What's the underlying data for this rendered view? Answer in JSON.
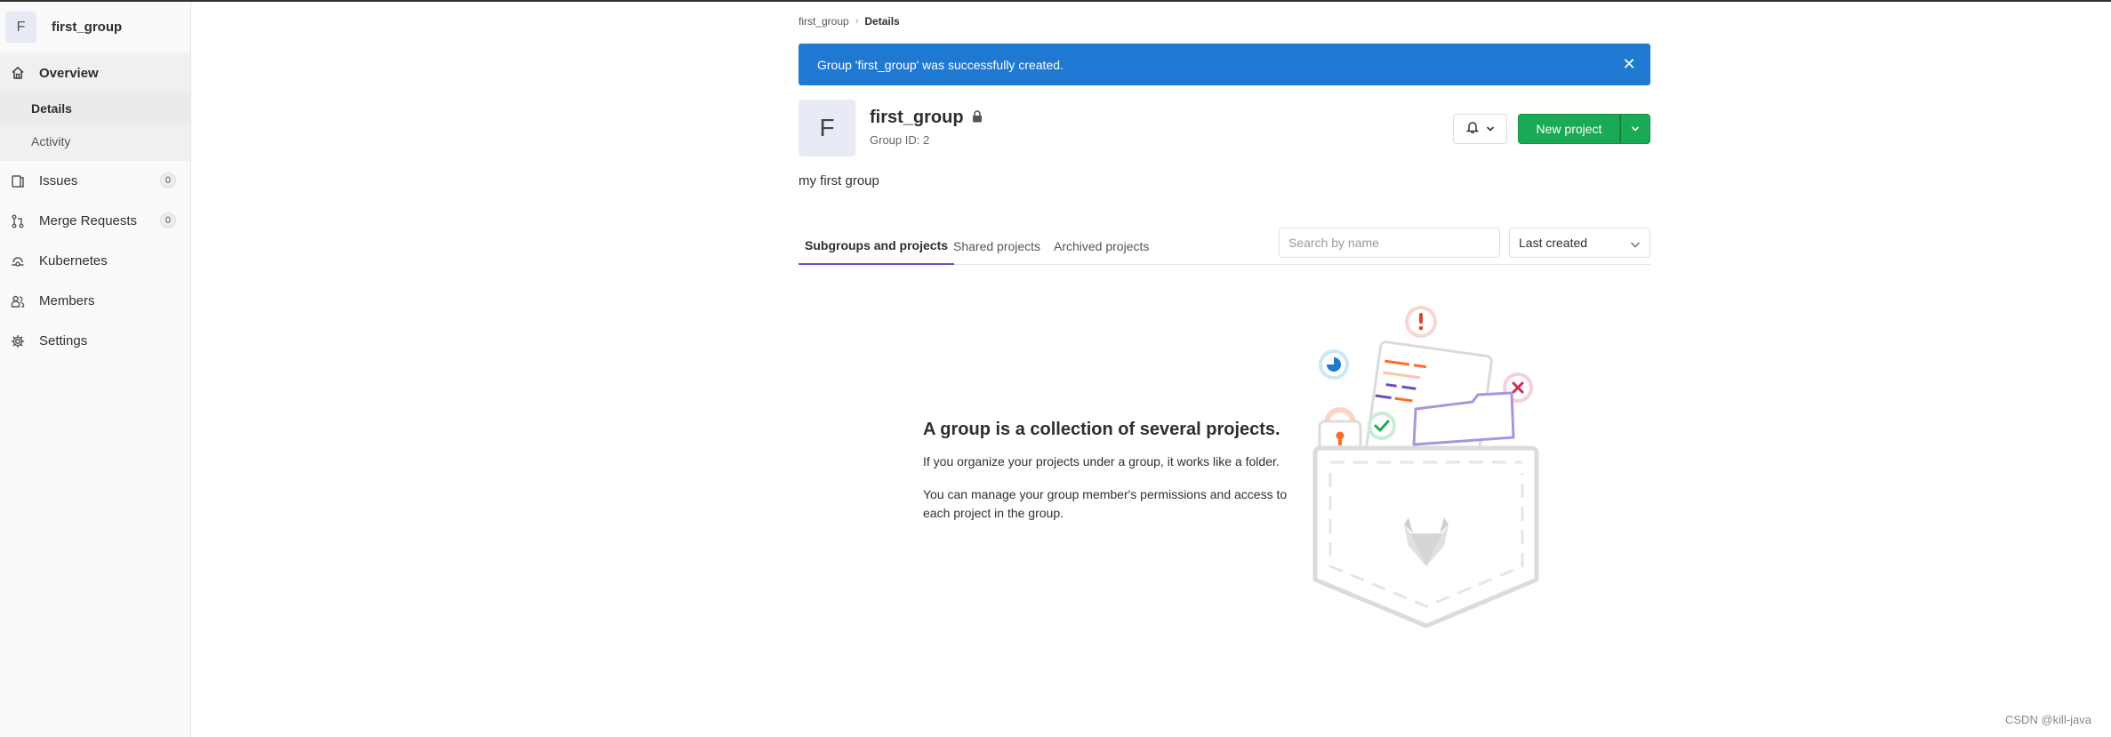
{
  "group": {
    "initial": "F",
    "name": "first_group",
    "id_text": "Group ID: 2",
    "description": "my first group"
  },
  "sidebar": {
    "items": [
      {
        "label": "Overview",
        "icon": "home-icon"
      },
      {
        "label": "Details"
      },
      {
        "label": "Activity"
      },
      {
        "label": "Issues",
        "count": "0",
        "icon": "issues-icon"
      },
      {
        "label": "Merge Requests",
        "count": "0",
        "icon": "merge-request-icon"
      },
      {
        "label": "Kubernetes",
        "icon": "kubernetes-icon"
      },
      {
        "label": "Members",
        "icon": "users-icon"
      },
      {
        "label": "Settings",
        "icon": "gear-icon"
      }
    ]
  },
  "breadcrumb": {
    "parent": "first_group",
    "current": "Details"
  },
  "flash": {
    "message": "Group 'first_group' was successfully created.",
    "close_glyph": "✕"
  },
  "actions": {
    "new_project": "New project"
  },
  "tabs": [
    {
      "label": "Subgroups and projects",
      "active": true
    },
    {
      "label": "Shared projects",
      "active": false
    },
    {
      "label": "Archived projects",
      "active": false
    }
  ],
  "filter": {
    "search_placeholder": "Search by name",
    "sort_selected": "Last created"
  },
  "empty_state": {
    "title": "A group is a collection of several projects.",
    "p1": "If you organize your projects under a group, it works like a folder.",
    "p2": "You can manage your group member's permissions and access to each project in the group."
  },
  "watermark": "CSDN @kill-java",
  "colors": {
    "flash_bg": "#1f78d1",
    "new_project_bg": "#1aaa55",
    "active_tab_underline": "#6b4fbb"
  }
}
